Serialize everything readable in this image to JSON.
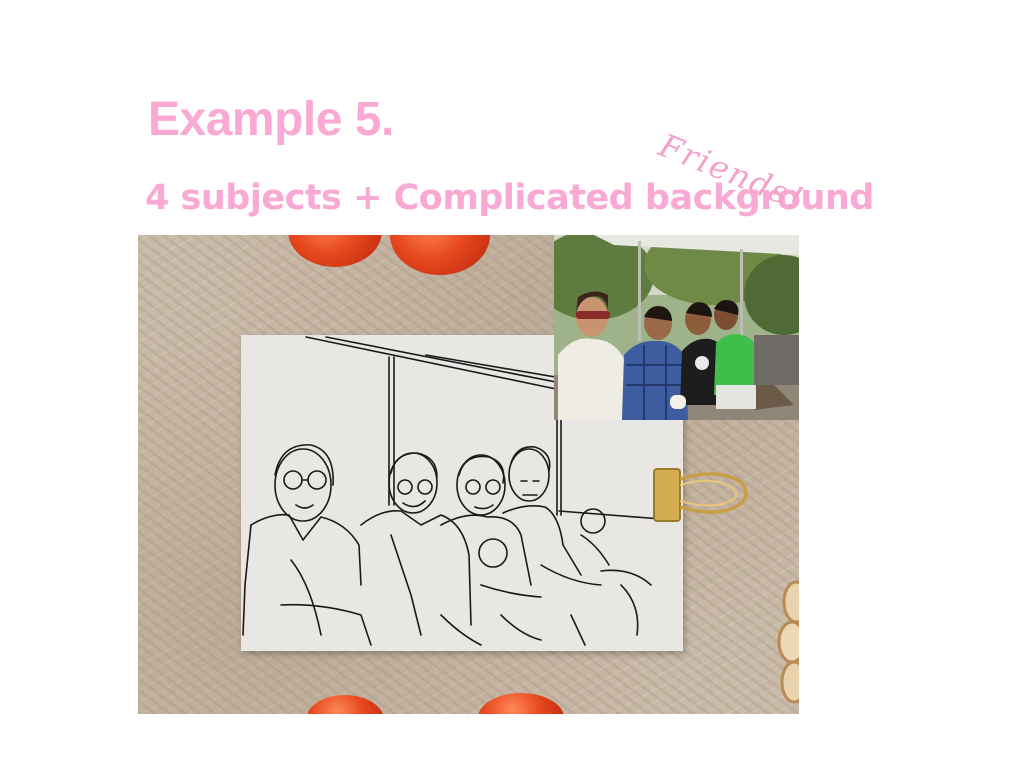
{
  "slide": {
    "title": "Example 5.",
    "subtitle": "4 subjects + Complicated background",
    "note": "Friends!"
  },
  "colors": {
    "heading": "#f9a9d3",
    "note": "#f4a0cb",
    "tablecloth": "#c9b9a7",
    "tomato": "#e8491f",
    "card": "#e9e7e3",
    "clip": "#d9b35a"
  },
  "mockup": {
    "card_content": "line-art-drawing",
    "inset_content": "reference-photo",
    "props": [
      "tomato",
      "binder-clip-icon",
      "garlic-slices"
    ]
  }
}
